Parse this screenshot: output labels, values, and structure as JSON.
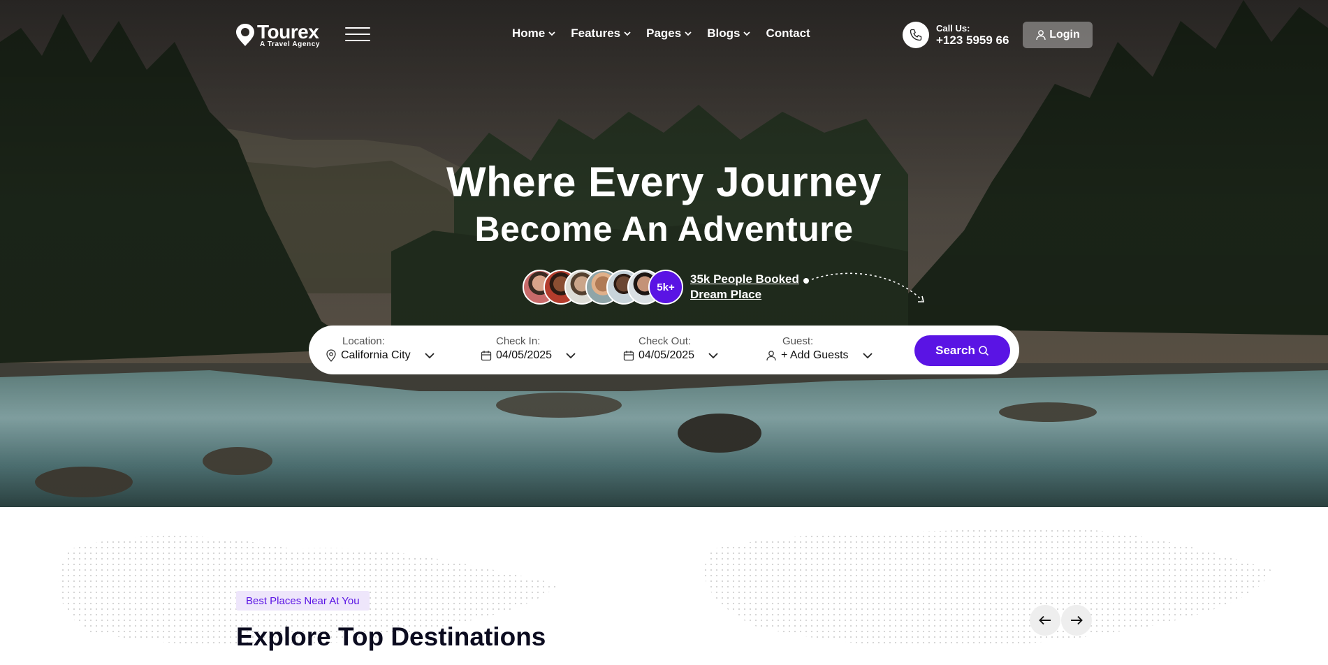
{
  "brand": {
    "name": "Tourex",
    "tagline": "A Travel Agency",
    "accent_color": "#5a14e4"
  },
  "header": {
    "menu_icon": "hamburger-icon",
    "nav": [
      {
        "label": "Home",
        "has_dropdown": true
      },
      {
        "label": "Features",
        "has_dropdown": true
      },
      {
        "label": "Pages",
        "has_dropdown": true
      },
      {
        "label": "Blogs",
        "has_dropdown": true
      },
      {
        "label": "Contact",
        "has_dropdown": false
      }
    ],
    "call": {
      "label": "Call Us:",
      "number": "+123 5959 66",
      "icon": "phone-icon"
    },
    "login_label": "Login"
  },
  "hero": {
    "title_line1": "Where Every Journey",
    "title_line2": "Become An Adventure",
    "avatar_count": 6,
    "count_badge": "5k+",
    "booked_line1": "35k People Booked",
    "booked_line2": "Dream Place"
  },
  "search": {
    "location": {
      "label": "Location:",
      "value": "California City",
      "icon": "map-pin-icon"
    },
    "check_in": {
      "label": "Check In:",
      "value": "04/05/2025",
      "icon": "calendar-icon"
    },
    "check_out": {
      "label": "Check Out:",
      "value": "04/05/2025",
      "icon": "calendar-icon"
    },
    "guest": {
      "label": "Guest:",
      "value": "+ Add Guests",
      "icon": "user-icon"
    },
    "button_label": "Search"
  },
  "section": {
    "tag": "Best Places Near At You",
    "title": "Explore Top Destinations",
    "prev_icon": "arrow-left-icon",
    "next_icon": "arrow-right-icon"
  }
}
